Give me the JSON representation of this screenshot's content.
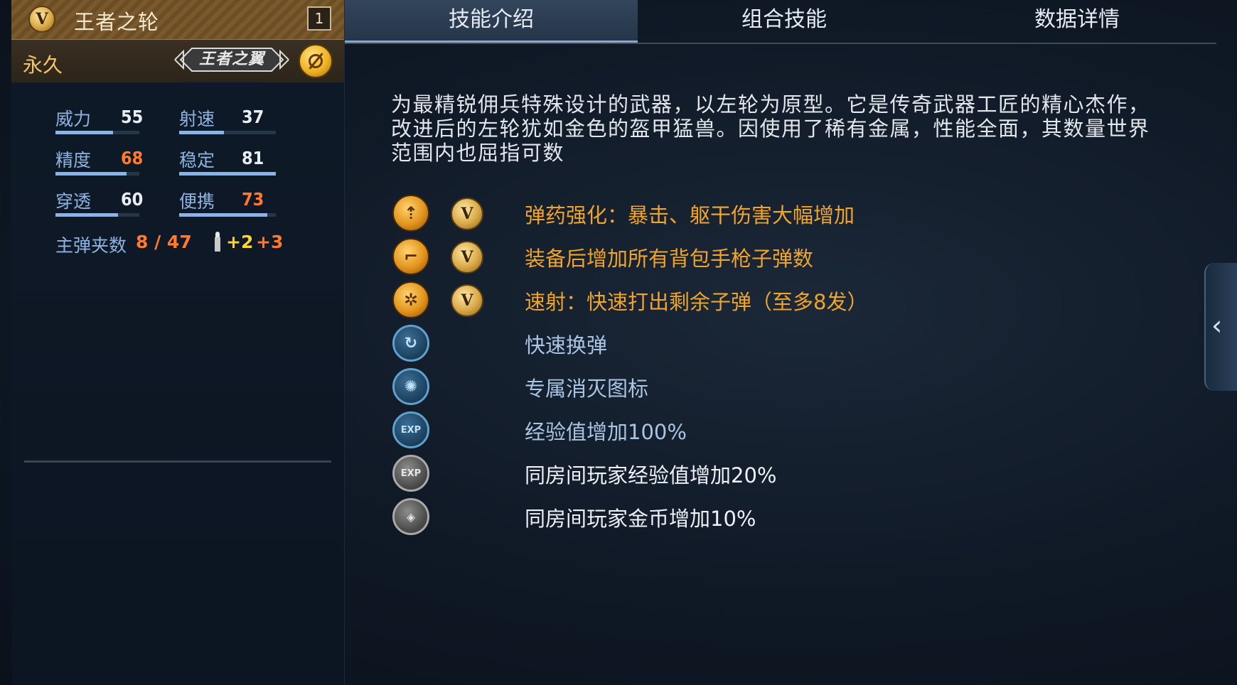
{
  "header": {
    "weapon_name": "王者之轮",
    "count": "1",
    "duration": "永久",
    "rank_emblem_text": "王者之翼",
    "vip_badge_letter": "V"
  },
  "stats": [
    {
      "label": "威力",
      "value": "55",
      "value_color": "#e8edf3",
      "bar_fraction": 0.55
    },
    {
      "label": "射速",
      "value": "37",
      "value_color": "#e8edf3",
      "bar_fraction": 0.37
    },
    {
      "label": "精度",
      "value": "68",
      "value_color": "#ff7a2e",
      "bar_fraction": 0.68
    },
    {
      "label": "稳定",
      "value": "81",
      "value_color": "#e8edf3",
      "bar_fraction": 0.81
    },
    {
      "label": "穿透",
      "value": "60",
      "value_color": "#e8edf3",
      "bar_fraction": 0.6
    },
    {
      "label": "便携",
      "value": "73",
      "value_color": "#ff7a2e",
      "bar_fraction": 0.73
    }
  ],
  "ammo": {
    "label": "主弹夹数",
    "value": "8 / 47",
    "bonus_a": "+2",
    "bonus_b": "+3"
  },
  "tabs": [
    {
      "label": "技能介绍",
      "active": true
    },
    {
      "label": "组合技能",
      "active": false
    },
    {
      "label": "数据详情",
      "active": false
    }
  ],
  "description": "为最精锐佣兵特殊设计的武器，以左轮为原型。它是传奇武器工匠的精心杰作，改进后的左轮犹如金色的盔甲猛兽。因使用了稀有金属，性能全面，其数量世界范围内也屈指可数",
  "skills": [
    {
      "text": "弹药强化：暴击、躯干伤害大幅增加",
      "icon": "bullet-upgrade-icon",
      "style": "gold",
      "has_v": true
    },
    {
      "text": "装备后增加所有背包手枪子弹数",
      "icon": "pistol-icon",
      "style": "gold",
      "has_v": true
    },
    {
      "text": "速射：快速打出剩余子弹（至多8发）",
      "icon": "revolver-cylinder-icon",
      "style": "gold",
      "has_v": true
    },
    {
      "text": "快速换弹",
      "icon": "fast-reload-icon",
      "style": "blue",
      "has_v": false
    },
    {
      "text": "专属消灭图标",
      "icon": "kill-icon",
      "style": "blue",
      "has_v": false
    },
    {
      "text": "经验值增加100%",
      "icon": "exp-icon",
      "style": "blue",
      "has_v": false
    },
    {
      "text": "同房间玩家经验值增加20%",
      "icon": "room-exp-icon",
      "style": "gray",
      "has_v": false
    },
    {
      "text": "同房间玩家金币增加10%",
      "icon": "room-gold-icon",
      "style": "gray",
      "has_v": false
    }
  ],
  "colors": {
    "gold_text": "#f0a42d",
    "blue_text": "#a9c5e4",
    "highlight_orange": "#ff7a2e"
  }
}
